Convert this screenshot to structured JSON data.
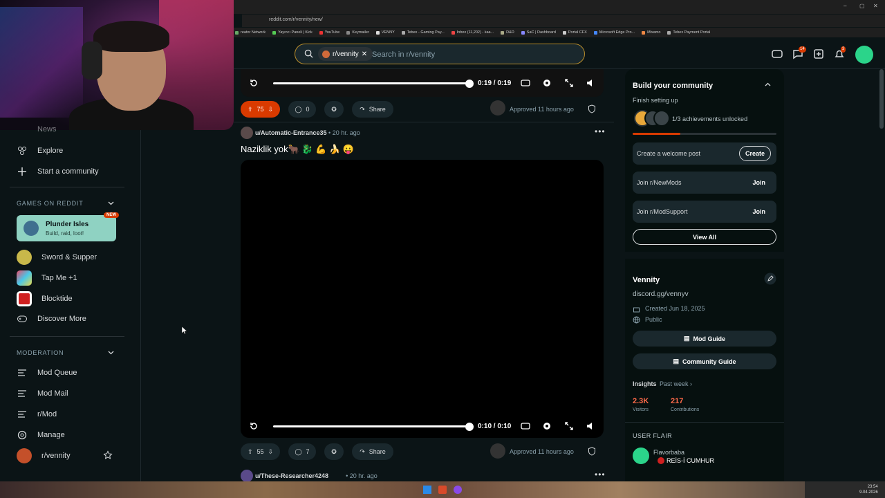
{
  "browser": {
    "url": "reddit.com/r/vennity/new/",
    "bookmarks": [
      "reator Network",
      "Yayıncı Paneli | Kick",
      "YouTube",
      "Keymailer",
      "VENNY",
      "Tebex - Gaming Pay...",
      "Inbox (11,202) - kaa...",
      "D&D",
      "SaC | Dashboard",
      "Portal CFX",
      "Microsoft Edge Pro...",
      "Mixamo",
      "Tebex Payment Portal"
    ]
  },
  "header": {
    "subreddit_chip": "r/vennity",
    "search_placeholder": "Search in r/vennity",
    "chat_badge": "14",
    "notif_badge": "3"
  },
  "left_sidebar": {
    "partial_item": "News",
    "explore": "Explore",
    "start_community": "Start a community",
    "games_header": "GAMES ON REDDIT",
    "featured_game": {
      "title": "Plunder Isles",
      "subtitle": "Build, raid, loot!",
      "badge": "NEW"
    },
    "games": [
      "Sword & Supper",
      "Tap Me +1",
      "Blocktide",
      "Discover More"
    ],
    "moderation_header": "MODERATION",
    "moderation": [
      "Mod Queue",
      "Mod Mail",
      "r/Mod",
      "Manage",
      "r/vennity"
    ]
  },
  "feed": {
    "post1": {
      "video_time": "0:19 / 0:19",
      "progress": 1.0,
      "votes": "75",
      "comments": "0",
      "share": "Share",
      "approved": "Approved 11 hours ago"
    },
    "post2": {
      "user": "u/Automatic-Entrance35",
      "time": "• 20 hr. ago",
      "title": "Naziklik yok🐂 🐉 💪 🍌 😛",
      "video_time": "0:10 / 0:10",
      "progress": 1.0,
      "votes": "55",
      "comments": "7",
      "share": "Share",
      "approved": "Approved 11 hours ago"
    },
    "post3": {
      "user": "u/These-Researcher4248",
      "time": "• 20 hr. ago"
    }
  },
  "right_sidebar": {
    "build_title": "Build your community",
    "finish_setup": "Finish setting up",
    "achievements": "1/3 achievements unlocked",
    "achievement_progress": 0.333,
    "tasks": [
      {
        "label": "Create a welcome post",
        "action": "Create"
      },
      {
        "label": "Join r/NewMods",
        "action": "Join"
      },
      {
        "label": "Join r/ModSupport",
        "action": "Join"
      }
    ],
    "view_all": "View All",
    "community_name": "Vennity",
    "community_desc": "discord.gg/vennyv",
    "created": "Created Jun 18, 2025",
    "visibility": "Public",
    "mod_guide": "Mod Guide",
    "community_guide": "Community Guide",
    "insights": "Insights",
    "insights_period": "Past week ›",
    "visitors_value": "2.3K",
    "visitors_label": "Visitors",
    "contrib_value": "217",
    "contrib_label": "Contributions",
    "user_flair_header": "USER FLAIR",
    "flair_user": "Flavorbaba",
    "flair_text": "REİS-İ CUMHUR"
  },
  "taskbar": {
    "time": "23:54",
    "date": "9.04.2026"
  },
  "colors": {
    "accent": "#d93a00",
    "background": "#0b1416",
    "card": "#1a282d"
  }
}
